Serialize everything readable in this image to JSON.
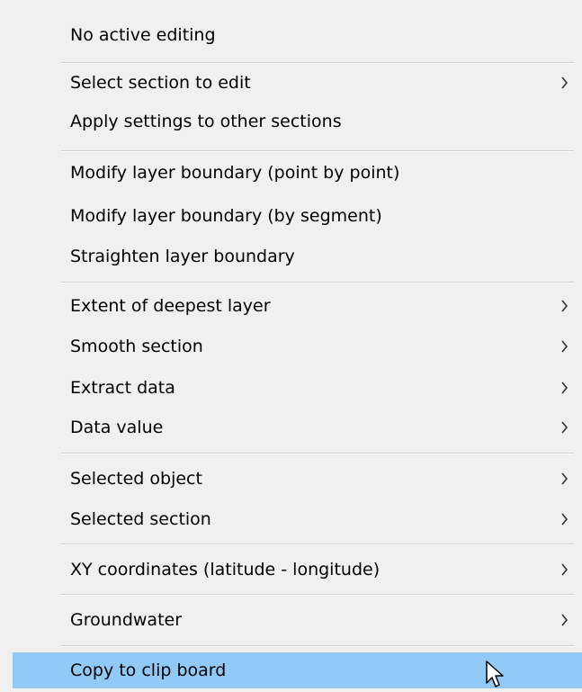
{
  "menu": {
    "items": [
      {
        "label": "No active editing",
        "has_submenu": false
      },
      {
        "label": "Select section to edit",
        "has_submenu": true
      },
      {
        "label": "Apply settings to other sections",
        "has_submenu": false
      },
      {
        "label": "Modify layer boundary (point by point)",
        "has_submenu": false
      },
      {
        "label": "Modify layer boundary (by segment)",
        "has_submenu": false
      },
      {
        "label": "Straighten layer boundary",
        "has_submenu": false
      },
      {
        "label": "Extent of deepest layer",
        "has_submenu": true
      },
      {
        "label": "Smooth section",
        "has_submenu": true
      },
      {
        "label": "Extract data",
        "has_submenu": true
      },
      {
        "label": "Data value",
        "has_submenu": true
      },
      {
        "label": "Selected object",
        "has_submenu": true
      },
      {
        "label": "Selected section",
        "has_submenu": true
      },
      {
        "label": "XY coordinates (latitude - longitude)",
        "has_submenu": true
      },
      {
        "label": "Groundwater",
        "has_submenu": true
      },
      {
        "label": "Copy to clip board",
        "has_submenu": false,
        "highlighted": true
      }
    ]
  },
  "colors": {
    "menu_background": "#f0f0f0",
    "highlight": "#91c9f7",
    "separator": "#cfcfcf"
  },
  "icons": {
    "submenu_arrow": "chevron-right-icon",
    "cursor": "mouse-pointer-icon"
  }
}
